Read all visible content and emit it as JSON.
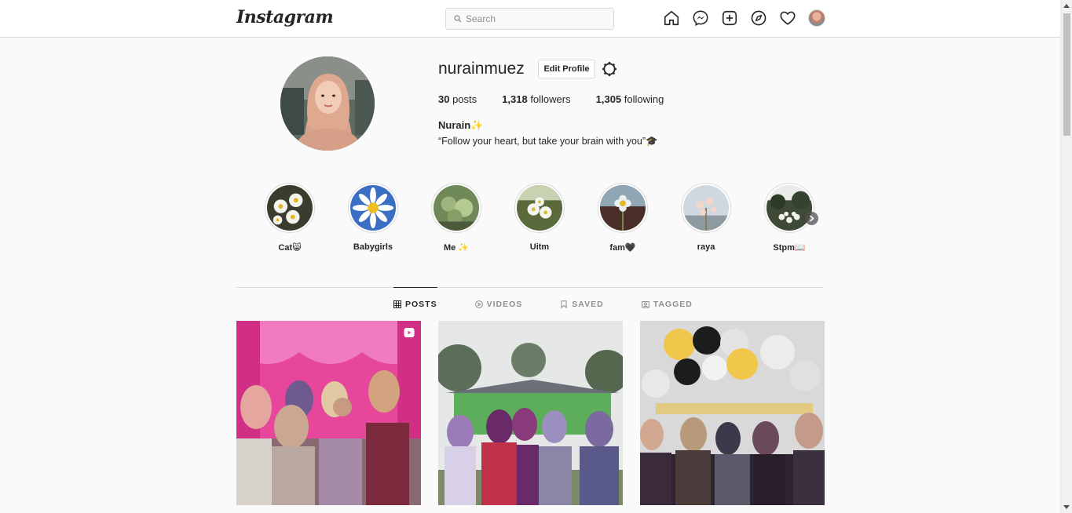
{
  "header": {
    "logo": "Instagram",
    "search_placeholder": "Search",
    "icons": [
      "home-icon",
      "messenger-icon",
      "new-post-icon",
      "explore-icon",
      "activity-heart-icon",
      "profile-avatar"
    ]
  },
  "profile": {
    "username": "nurainmuez",
    "edit_label": "Edit Profile",
    "posts_count": "30",
    "posts_label": " posts",
    "followers_count": "1,318",
    "followers_label": " followers",
    "following_count": "1,305",
    "following_label": " following",
    "full_name": "Nurain✨",
    "bio": "“Follow your heart, but take your brain with you”🎓"
  },
  "highlights": [
    {
      "label": "Cat😸"
    },
    {
      "label": "Babygirls"
    },
    {
      "label": "Me ✨"
    },
    {
      "label": "Uitm"
    },
    {
      "label": "fam🖤"
    },
    {
      "label": "raya"
    },
    {
      "label": "Stpm📖"
    }
  ],
  "tabs": [
    {
      "label": "POSTS",
      "icon": "grid-icon",
      "active": true
    },
    {
      "label": "VIDEOS",
      "icon": "play-icon",
      "active": false
    },
    {
      "label": "SAVED",
      "icon": "bookmark-icon",
      "active": false
    },
    {
      "label": "TAGGED",
      "icon": "tag-icon",
      "active": false
    }
  ],
  "colors": {
    "background": "#fafafa",
    "text": "#262626",
    "secondary_text": "#8e8e8e",
    "border": "#dbdbdb"
  }
}
